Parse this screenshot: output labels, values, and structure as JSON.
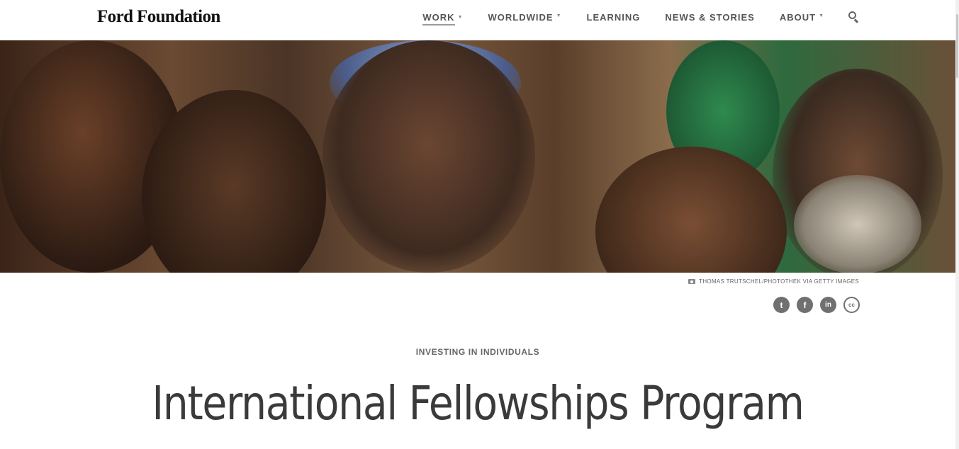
{
  "header": {
    "logo": "Ford Foundation",
    "nav": [
      {
        "label": "WORK",
        "has_dropdown": true,
        "active": true
      },
      {
        "label": "WORLDWIDE",
        "has_dropdown": true,
        "active": false
      },
      {
        "label": "LEARNING",
        "has_dropdown": false,
        "active": false
      },
      {
        "label": "NEWS & STORIES",
        "has_dropdown": false,
        "active": false
      },
      {
        "label": "ABOUT",
        "has_dropdown": true,
        "active": false
      }
    ],
    "caret": "▼",
    "search_icon": "search-icon"
  },
  "hero": {
    "credit": "THOMAS TRUTSCHEL/PHOTOTHEK VIA GETTY IMAGES"
  },
  "share": {
    "twitter": "t",
    "facebook": "f",
    "linkedin": "in",
    "cc": "cc"
  },
  "page": {
    "eyebrow": "INVESTING IN INDIVIDUALS",
    "title": "International Fellowships Program"
  },
  "colors": {
    "text_dark": "#3a3a3a",
    "nav_text": "#555555",
    "icon_gray": "#707070"
  }
}
